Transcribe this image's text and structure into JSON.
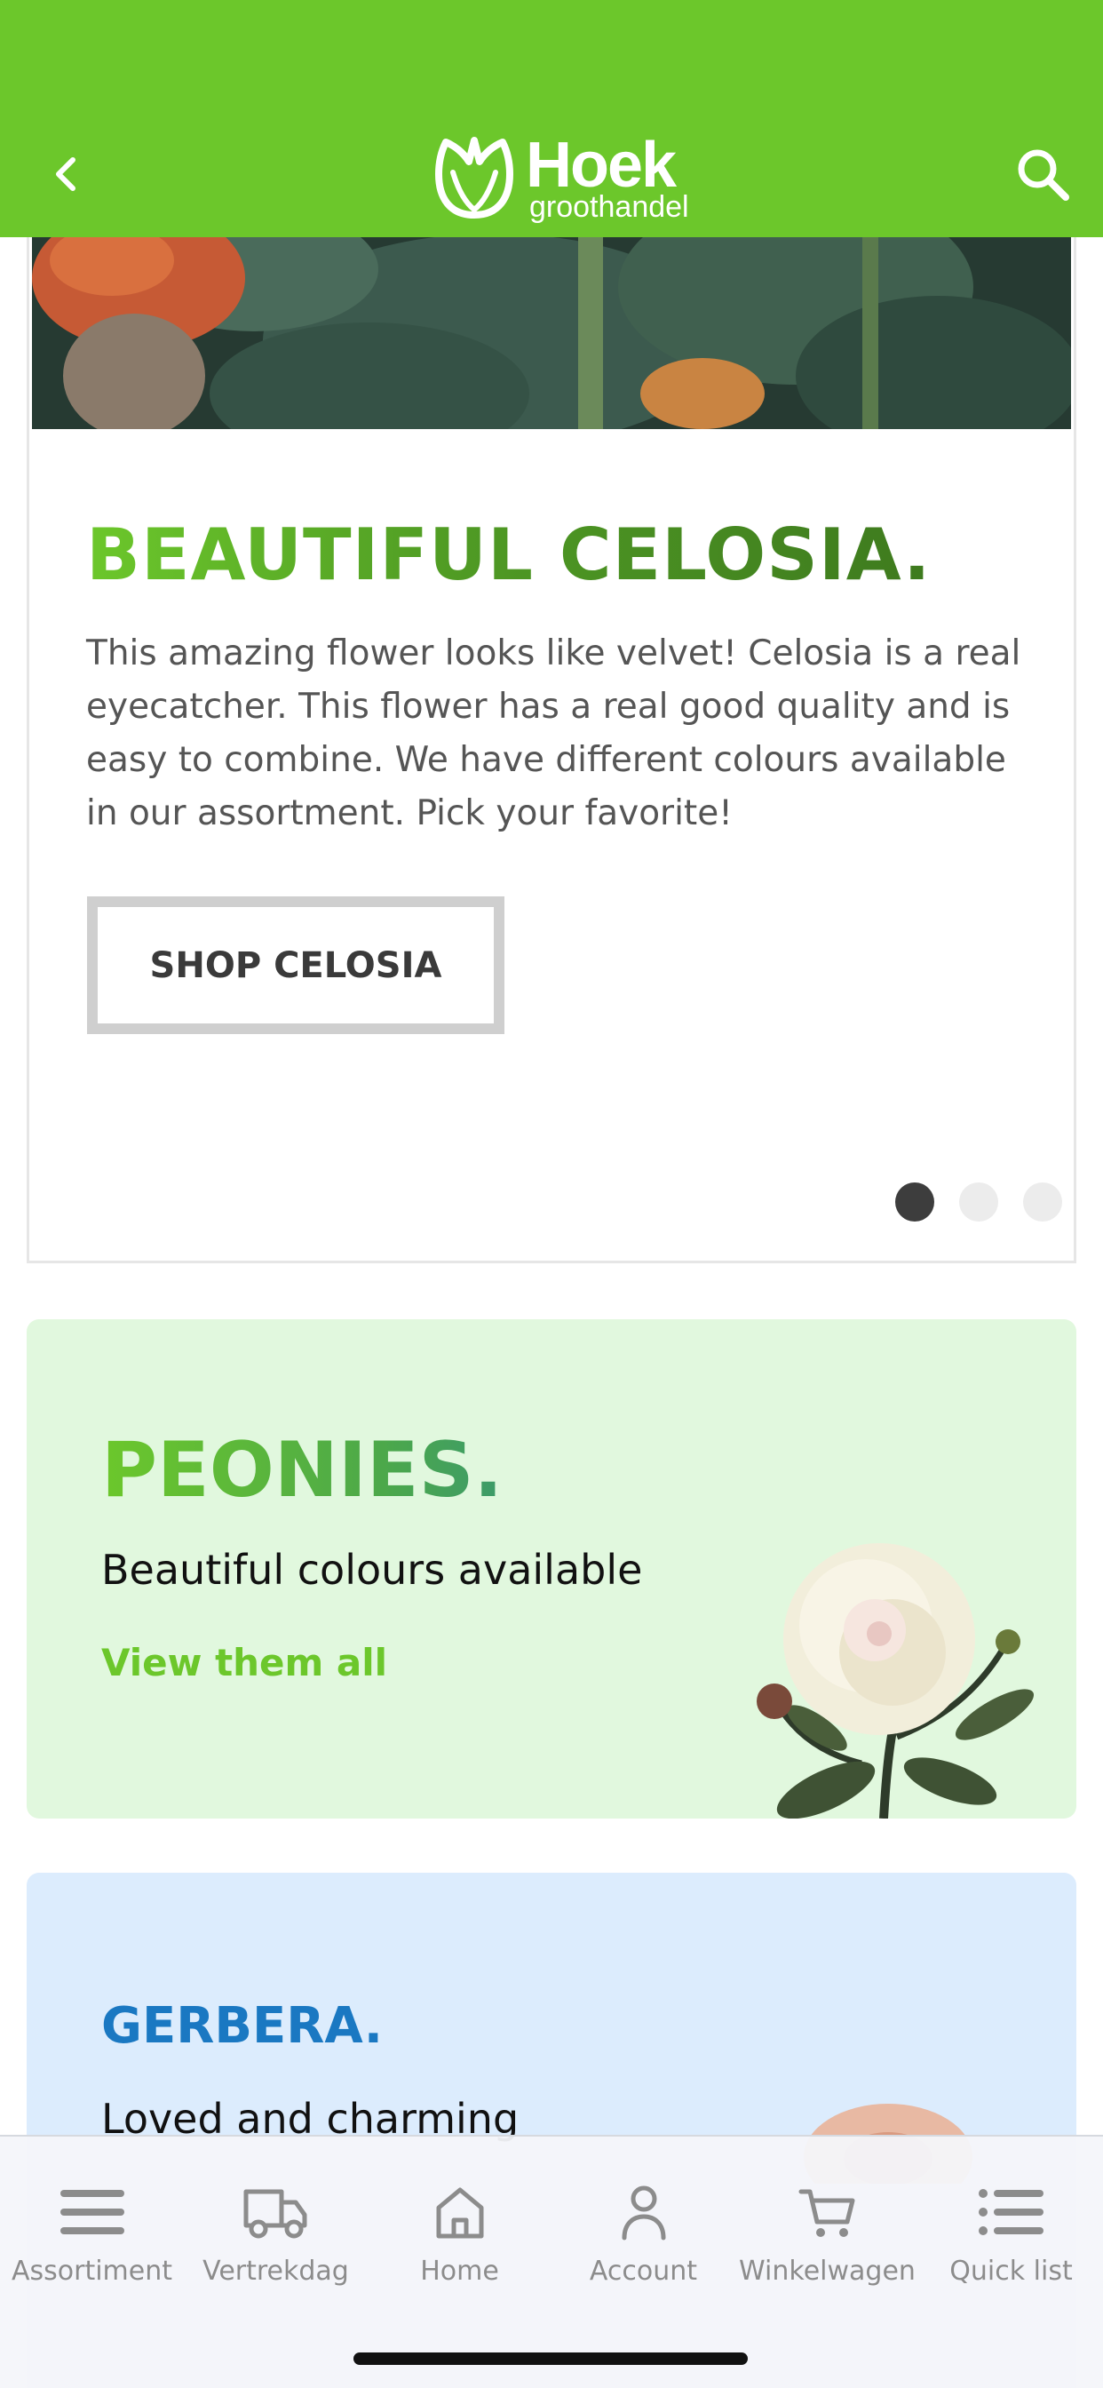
{
  "header": {
    "brand_name": "Hoek",
    "brand_sub": "groothandel",
    "brand_color": "#6cc72b",
    "back_icon": "chevron-left-icon",
    "search_icon": "search-icon"
  },
  "hero": {
    "title": "BEAUTIFUL CELOSIA.",
    "text": "This amazing flower looks like velvet! Celosia is a real eyecatcher. This flower has a real good quality and is easy to combine. We have different colours available in our assortment. Pick your favorite!",
    "button_label": "SHOP CELOSIA",
    "slide_count": 3,
    "active_slide": 1
  },
  "promos": [
    {
      "title": "PEONIES.",
      "subtitle": "Beautiful colours available",
      "link_label": "View them all",
      "background": "#e1f8de"
    },
    {
      "title": "GERBERA.",
      "subtitle": "Loved and charming",
      "background": "#dcecfd",
      "title_color": "#1a78c2"
    }
  ],
  "tabbar": {
    "items": [
      {
        "label": "Assortiment",
        "icon": "menu-icon"
      },
      {
        "label": "Vertrekdag",
        "icon": "truck-icon"
      },
      {
        "label": "Home",
        "icon": "home-icon"
      },
      {
        "label": "Account",
        "icon": "user-icon"
      },
      {
        "label": "Winkelwagen",
        "icon": "cart-icon"
      },
      {
        "label": "Quick list",
        "icon": "list-icon"
      }
    ]
  }
}
